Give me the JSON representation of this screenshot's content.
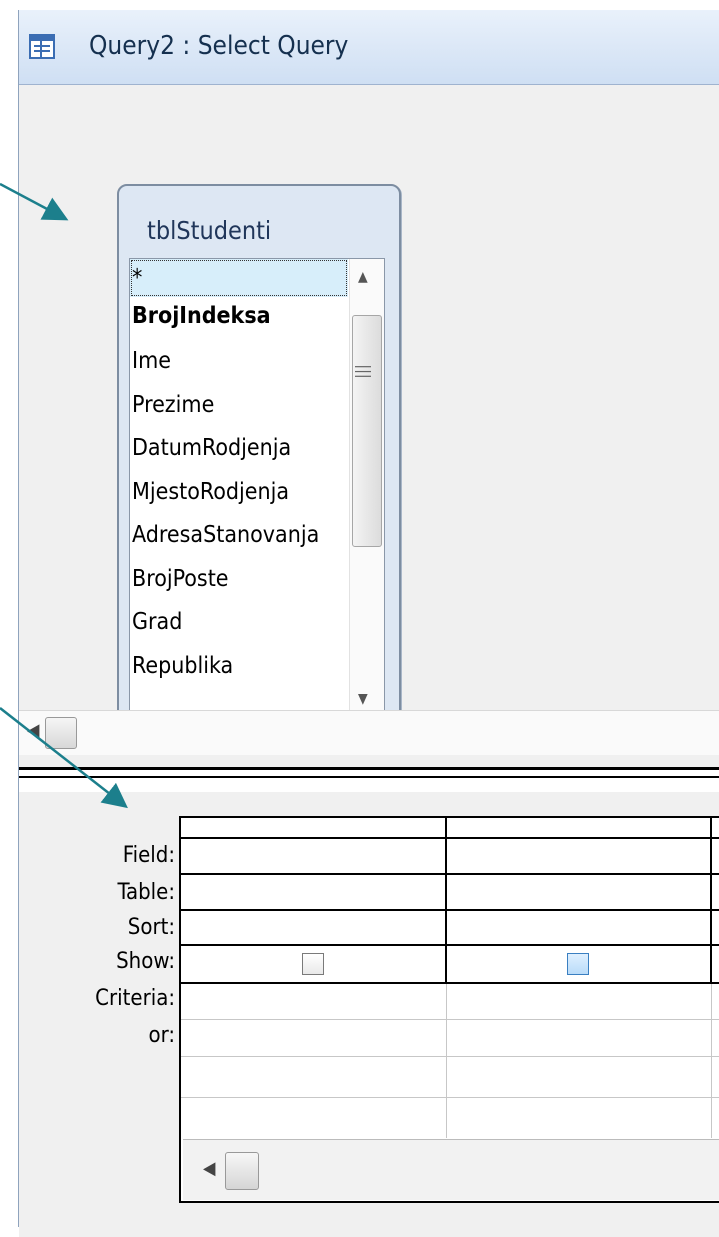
{
  "window": {
    "title": "Query2 : Select Query",
    "app_icon": "query-icon"
  },
  "table_box": {
    "name": "tblStudenti",
    "fields": [
      {
        "label": "*",
        "selected": true,
        "key": false
      },
      {
        "label": "BrojIndeksa",
        "selected": false,
        "key": true
      },
      {
        "label": "Ime",
        "selected": false,
        "key": false
      },
      {
        "label": "Prezime",
        "selected": false,
        "key": false
      },
      {
        "label": "DatumRodjenja",
        "selected": false,
        "key": false
      },
      {
        "label": "MjestoRodjenja",
        "selected": false,
        "key": false
      },
      {
        "label": "AdresaStanovanja",
        "selected": false,
        "key": false
      },
      {
        "label": "BrojPoste",
        "selected": false,
        "key": false
      },
      {
        "label": "Grad",
        "selected": false,
        "key": false
      },
      {
        "label": "Republika",
        "selected": false,
        "key": false
      }
    ],
    "scrollbar_icons": {
      "up": "arrow-up-icon",
      "down": "arrow-down-icon",
      "grip": "grip-icon"
    }
  },
  "design_grid": {
    "row_labels": {
      "field": "Field:",
      "table": "Table:",
      "sort": "Sort:",
      "show": "Show:",
      "criteria": "Criteria:",
      "or": "or:"
    },
    "columns": [
      {
        "field": "",
        "table": "",
        "sort": "",
        "show": false,
        "criteria": "",
        "or": ""
      },
      {
        "field": "",
        "table": "",
        "sort": "",
        "show": false,
        "criteria": "",
        "or": ""
      }
    ]
  },
  "colors": {
    "annotation_arrow": "#1c7f8c",
    "selection": "#d7eefa",
    "titlebar": "#cfdff3"
  }
}
